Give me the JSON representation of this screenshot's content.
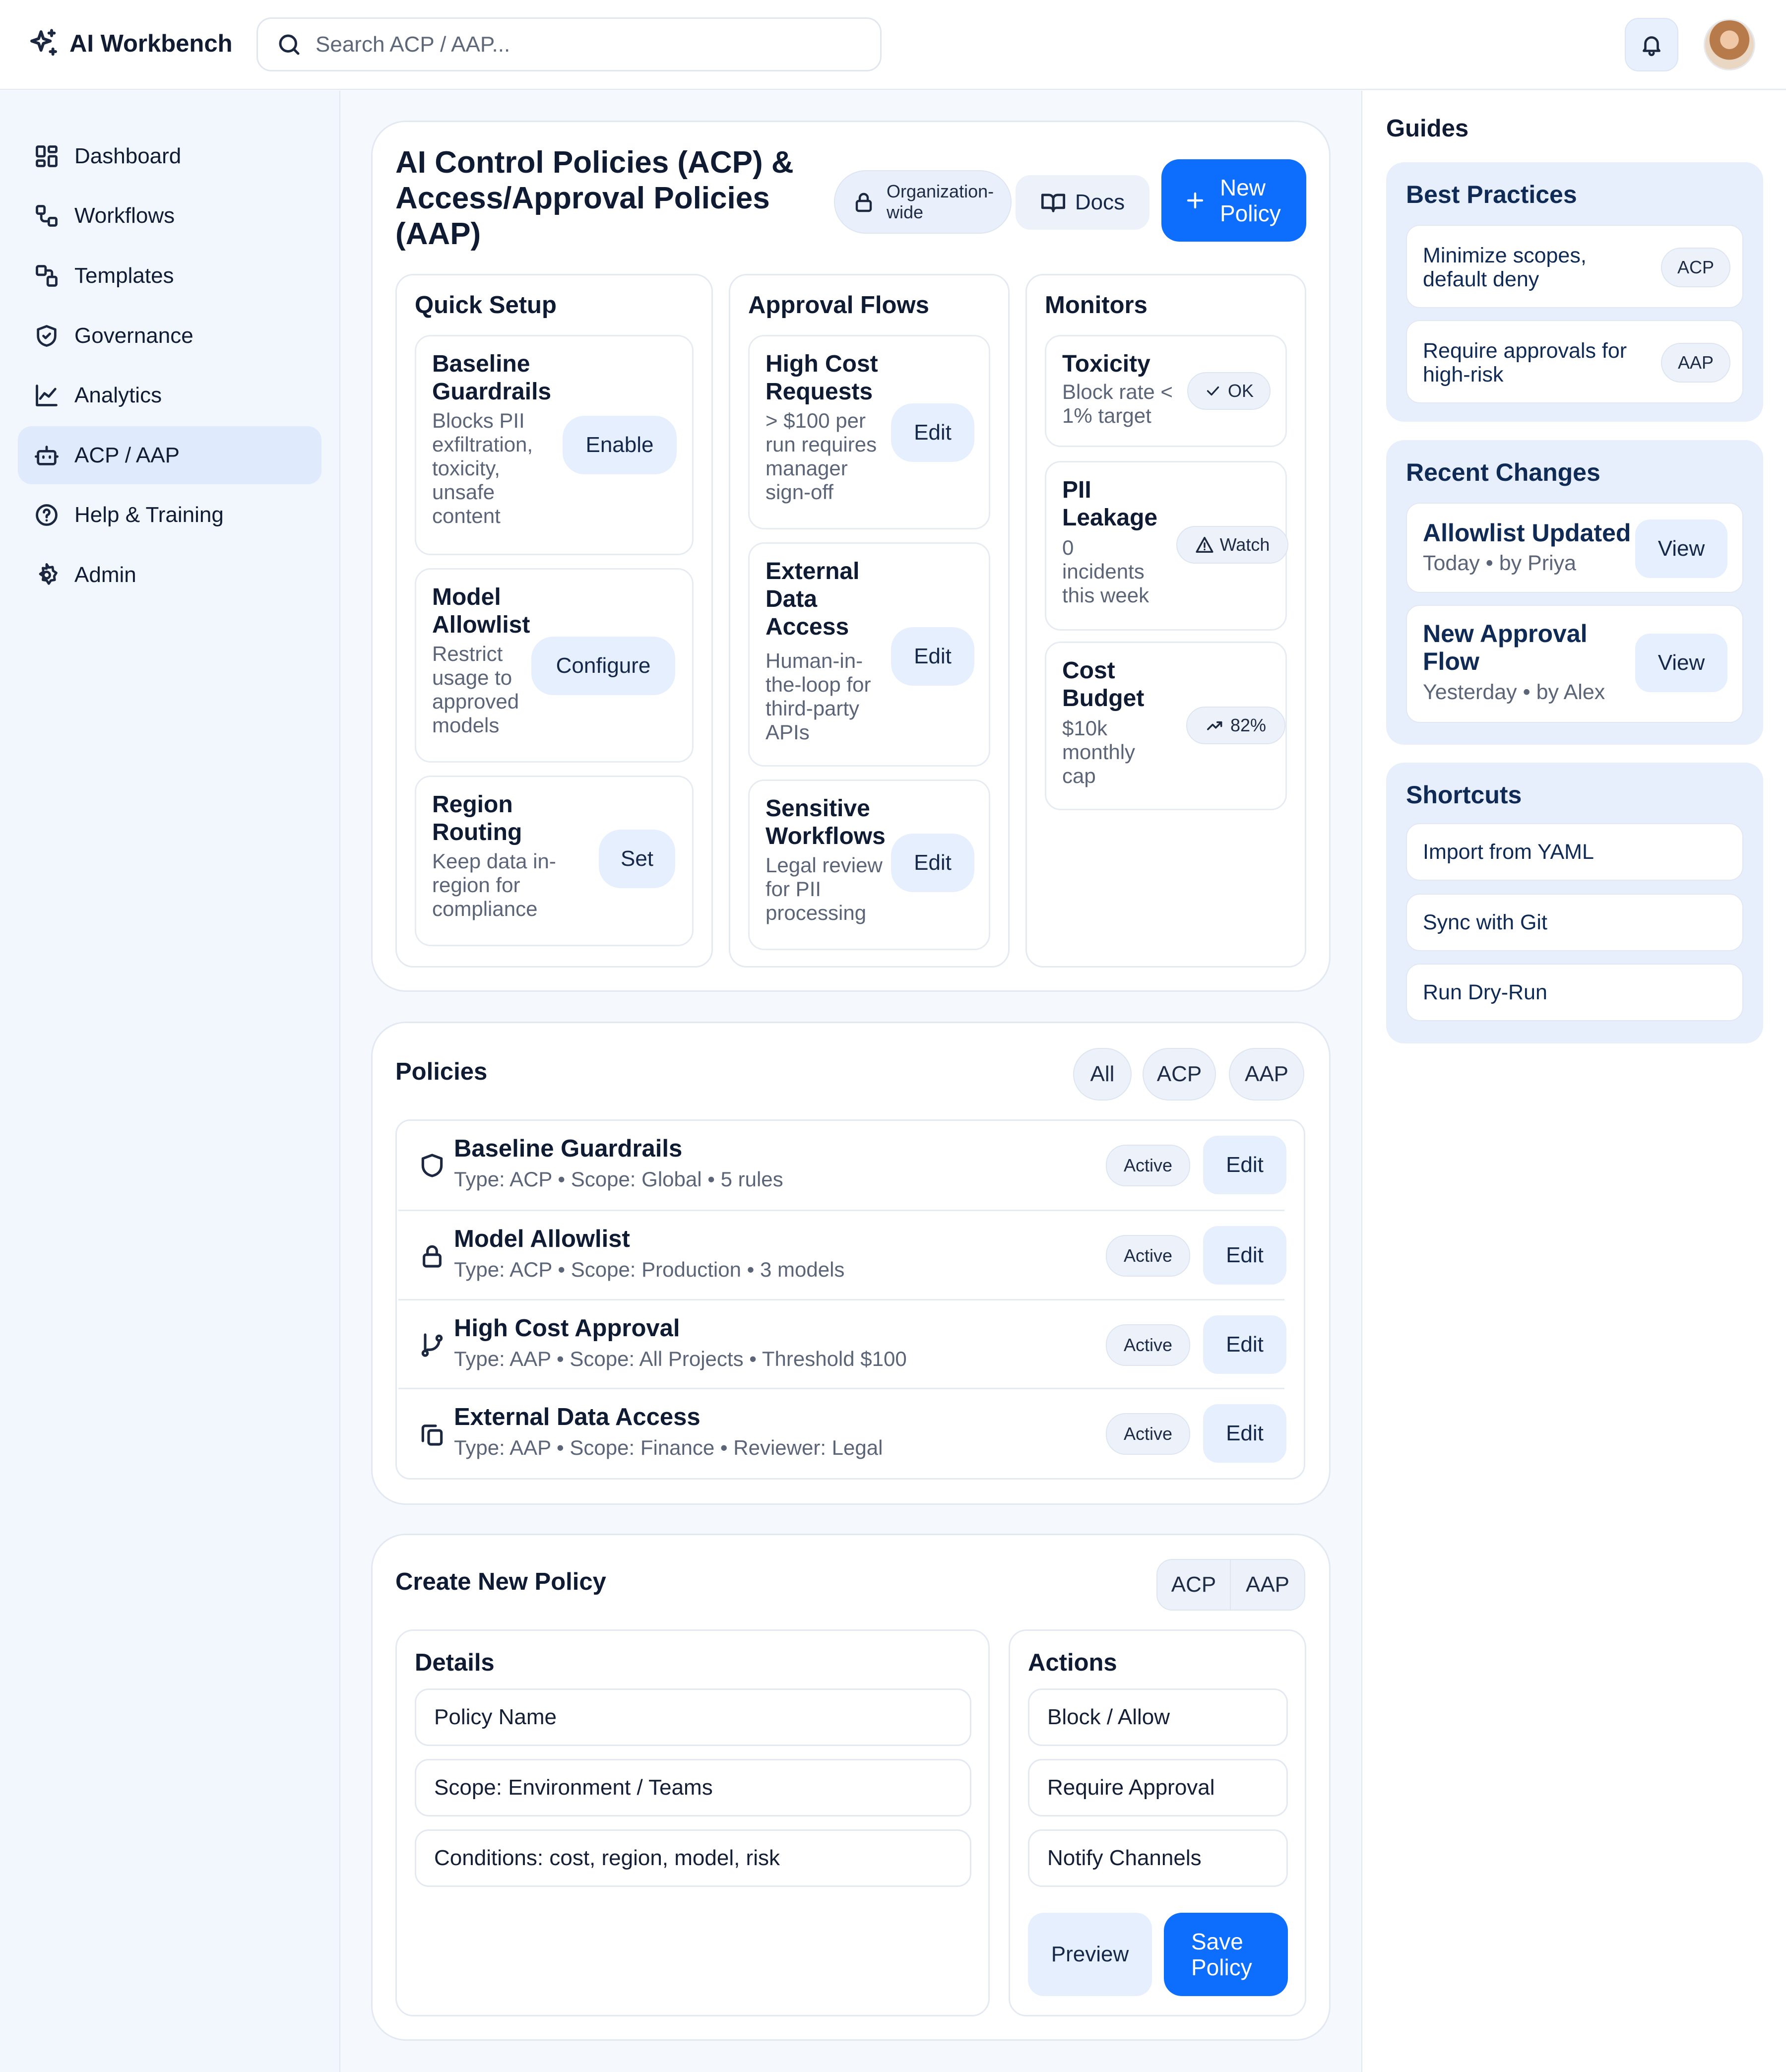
{
  "app": {
    "name": "AI Workbench"
  },
  "search": {
    "placeholder": "Search ACP / AAP..."
  },
  "sidebar": {
    "items": [
      {
        "label": "Dashboard",
        "icon": "grid-icon"
      },
      {
        "label": "Workflows",
        "icon": "workflow-icon"
      },
      {
        "label": "Templates",
        "icon": "templates-icon"
      },
      {
        "label": "Governance",
        "icon": "shield-icon"
      },
      {
        "label": "Analytics",
        "icon": "chart-icon"
      },
      {
        "label": "ACP / AAP",
        "icon": "bot-icon",
        "active": true
      },
      {
        "label": "Help & Training",
        "icon": "help-icon"
      },
      {
        "label": "Admin",
        "icon": "gear-icon"
      }
    ]
  },
  "header": {
    "title": "AI Control Policies (ACP) & Access/Approval Policies (AAP)",
    "scope_label": "Organization-wide",
    "docs_label": "Docs",
    "new_policy_label": "New Policy"
  },
  "quick_setup": {
    "title": "Quick Setup",
    "items": [
      {
        "title": "Baseline Guardrails",
        "desc": "Blocks PII exfiltration, toxicity, unsafe content",
        "action": "Enable"
      },
      {
        "title": "Model Allowlist",
        "desc": "Restrict usage to approved models",
        "action": "Configure"
      },
      {
        "title": "Region Routing",
        "desc": "Keep data in-region for compliance",
        "action": "Set"
      }
    ]
  },
  "approval_flows": {
    "title": "Approval Flows",
    "items": [
      {
        "title": "High Cost Requests",
        "desc": "> $100 per run requires manager sign-off",
        "action": "Edit"
      },
      {
        "title": "External Data Access",
        "desc": "Human-in-the-loop for third-party APIs",
        "action": "Edit"
      },
      {
        "title": "Sensitive Workflows",
        "desc": "Legal review for PII processing",
        "action": "Edit"
      }
    ]
  },
  "monitors": {
    "title": "Monitors",
    "items": [
      {
        "title": "Toxicity",
        "desc": "Block rate < 1% target",
        "status": "OK",
        "icon": "check-icon"
      },
      {
        "title": "PII Leakage",
        "desc": "0 incidents this week",
        "status": "Watch",
        "icon": "alert-icon"
      },
      {
        "title": "Cost Budget",
        "desc": "$10k monthly cap",
        "status": "82%",
        "icon": "trend-up-icon"
      }
    ]
  },
  "policies": {
    "title": "Policies",
    "filters": [
      "All",
      "ACP",
      "AAP"
    ],
    "rows": [
      {
        "name": "Baseline Guardrails",
        "meta": "Type: ACP • Scope: Global • 5 rules",
        "status": "Active",
        "action": "Edit",
        "icon": "shield-icon"
      },
      {
        "name": "Model Allowlist",
        "meta": "Type: ACP • Scope: Production • 3 models",
        "status": "Active",
        "action": "Edit",
        "icon": "lock-icon"
      },
      {
        "name": "High Cost Approval",
        "meta": "Type: AAP • Scope: All Projects • Threshold $100",
        "status": "Active",
        "action": "Edit",
        "icon": "branch-icon"
      },
      {
        "name": "External Data Access",
        "meta": "Type: AAP • Scope: Finance • Reviewer: Legal",
        "status": "Active",
        "action": "Edit",
        "icon": "copy-icon"
      }
    ]
  },
  "create_policy": {
    "title": "Create New Policy",
    "types": [
      "ACP",
      "AAP"
    ],
    "details_title": "Details",
    "fields": [
      "Policy Name",
      "Scope: Environment / Teams",
      "Conditions: cost, region, model, risk"
    ],
    "actions_title": "Actions",
    "actions": [
      "Block / Allow",
      "Require Approval",
      "Notify Channels"
    ],
    "preview_label": "Preview",
    "save_label": "Save Policy"
  },
  "guides": {
    "title": "Guides",
    "best_practices": {
      "title": "Best Practices",
      "items": [
        {
          "text": "Minimize scopes, default deny",
          "tag": "ACP"
        },
        {
          "text": "Require approvals for high-risk",
          "tag": "AAP"
        }
      ]
    },
    "recent_changes": {
      "title": "Recent Changes",
      "items": [
        {
          "title": "Allowlist Updated",
          "meta": "Today • by Priya",
          "action": "View"
        },
        {
          "title": "New Approval Flow",
          "meta": "Yesterday • by Alex",
          "action": "View"
        }
      ]
    },
    "shortcuts": {
      "title": "Shortcuts",
      "items": [
        "Import from YAML",
        "Sync with Git",
        "Run Dry-Run"
      ]
    }
  },
  "colors": {
    "primary": "#0d6efd",
    "accent_bg": "#e6effd",
    "text": "#0f1b33",
    "muted": "#5b6577"
  }
}
